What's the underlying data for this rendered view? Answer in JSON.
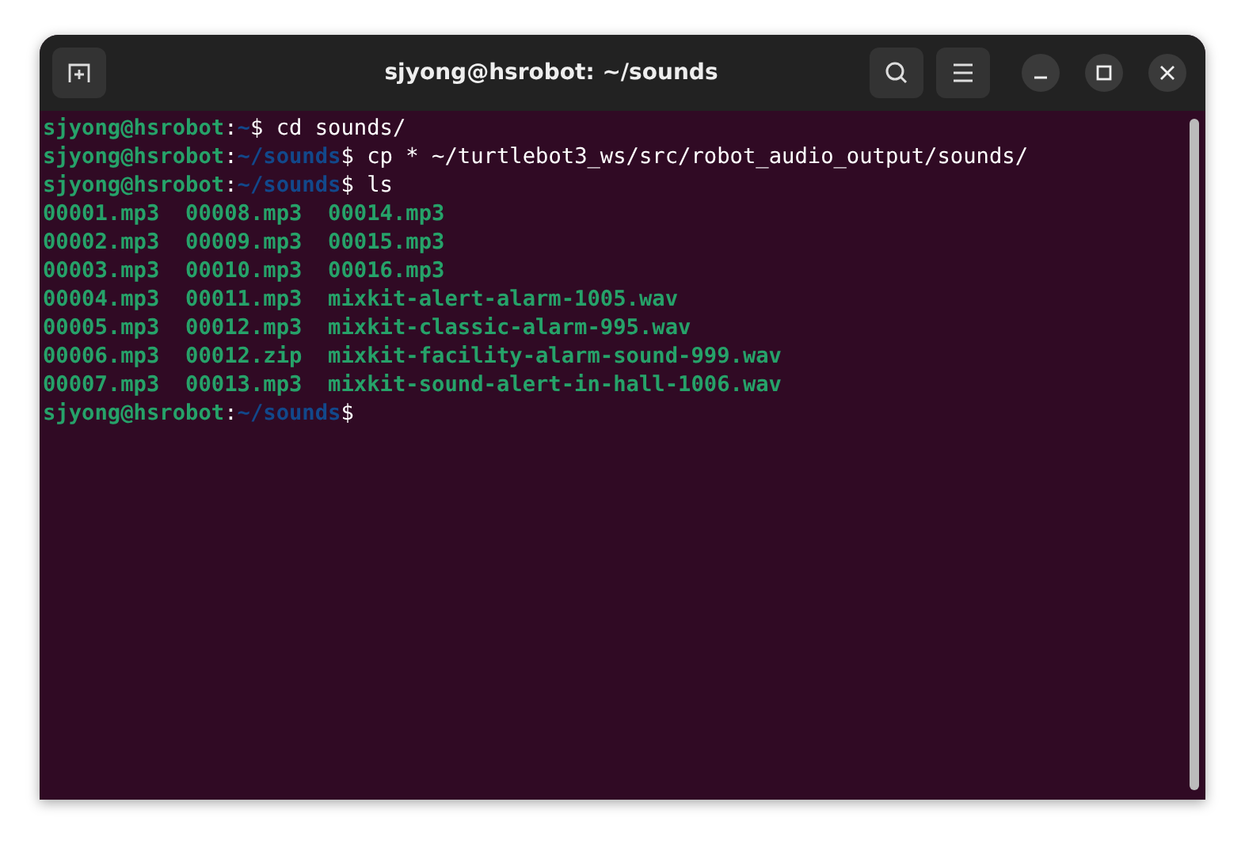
{
  "window": {
    "title": "sjyong@hsrobot: ~/sounds"
  },
  "terminal": {
    "lines": [
      [
        {
          "kind": "user",
          "text": "sjyong@hsrobot"
        },
        {
          "kind": "plain",
          "text": ":"
        },
        {
          "kind": "path",
          "text": "~"
        },
        {
          "kind": "plain",
          "text": "$ cd sounds/"
        }
      ],
      [
        {
          "kind": "user",
          "text": "sjyong@hsrobot"
        },
        {
          "kind": "plain",
          "text": ":"
        },
        {
          "kind": "path",
          "text": "~/sounds"
        },
        {
          "kind": "plain",
          "text": "$ cp * ~/turtlebot3_ws/src/robot_audio_output/sounds/"
        }
      ],
      [
        {
          "kind": "user",
          "text": "sjyong@hsrobot"
        },
        {
          "kind": "plain",
          "text": ":"
        },
        {
          "kind": "path",
          "text": "~/sounds"
        },
        {
          "kind": "plain",
          "text": "$ ls"
        }
      ],
      [
        {
          "kind": "file",
          "text": "00001.mp3  00008.mp3  00014.mp3"
        }
      ],
      [
        {
          "kind": "file",
          "text": "00002.mp3  00009.mp3  00015.mp3"
        }
      ],
      [
        {
          "kind": "file",
          "text": "00003.mp3  00010.mp3  00016.mp3"
        }
      ],
      [
        {
          "kind": "file",
          "text": "00004.mp3  00011.mp3  mixkit-alert-alarm-1005.wav"
        }
      ],
      [
        {
          "kind": "file",
          "text": "00005.mp3  00012.mp3  mixkit-classic-alarm-995.wav"
        }
      ],
      [
        {
          "kind": "file",
          "text": "00006.mp3  00012.zip  mixkit-facility-alarm-sound-999.wav"
        }
      ],
      [
        {
          "kind": "file",
          "text": "00007.mp3  00013.mp3  mixkit-sound-alert-in-hall-1006.wav"
        }
      ],
      [
        {
          "kind": "user",
          "text": "sjyong@hsrobot"
        },
        {
          "kind": "plain",
          "text": ":"
        },
        {
          "kind": "path",
          "text": "~/sounds"
        },
        {
          "kind": "plain",
          "text": "$"
        }
      ]
    ]
  }
}
